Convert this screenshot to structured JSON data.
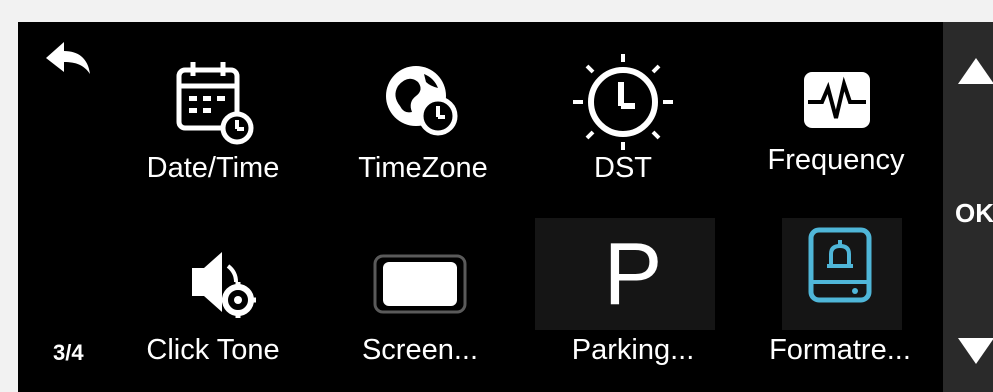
{
  "screen": {
    "back_icon": "back-arrow-icon",
    "page_indicator": "3/4",
    "items": [
      {
        "label": "Date/Time",
        "icon": "calendar-clock-icon"
      },
      {
        "label": "TimeZone",
        "icon": "globe-clock-icon"
      },
      {
        "label": "DST",
        "icon": "sun-clock-icon"
      },
      {
        "label": "Frequency",
        "icon": "waveform-icon"
      },
      {
        "label": "Click Tone",
        "icon": "speaker-gear-icon"
      },
      {
        "label": "Screen...",
        "icon": "screen-icon"
      },
      {
        "label": "Parking...",
        "icon": "parking-icon"
      },
      {
        "label": "Formatre...",
        "icon": "storage-bell-icon"
      }
    ],
    "accent_color": "#4fb6d8"
  },
  "nav": {
    "ok_label": "OK",
    "up_icon": "triangle-up-icon",
    "down_icon": "triangle-down-icon"
  }
}
